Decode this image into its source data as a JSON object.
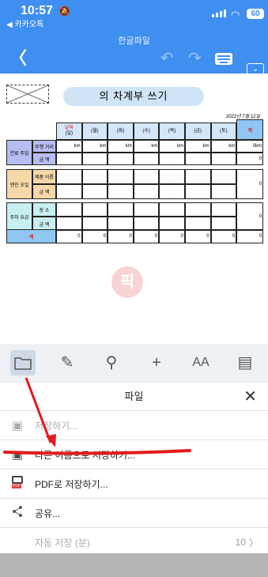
{
  "status": {
    "time": "10:57",
    "back_app": "◀ 카카오톡",
    "battery": "60"
  },
  "header": {
    "title": "한글파일"
  },
  "document": {
    "title": "의 차계부 쓰기",
    "date": "2022년 7월 12일",
    "days": [
      {
        "top": "날짜",
        "bottom": "(일)"
      },
      {
        "top": "",
        "bottom": "(월)"
      },
      {
        "top": "",
        "bottom": "(화)"
      },
      {
        "top": "",
        "bottom": "(수)"
      },
      {
        "top": "",
        "bottom": "(목)"
      },
      {
        "top": "",
        "bottom": "(금)"
      },
      {
        "top": "",
        "bottom": "(토)"
      }
    ],
    "total_header": "계",
    "fuel": {
      "label": "연료 주입",
      "sub1": "주행 거리",
      "sub2": "금 액",
      "unit": "km",
      "total_km": "0km",
      "total_amount": "0"
    },
    "oil": {
      "label": "엔진 오일",
      "sub1": "제품 이름",
      "sub2": "금 액",
      "total": "0"
    },
    "park": {
      "label": "주차 요금",
      "sub1": "장 소",
      "sub2": "금 액",
      "total": "0"
    },
    "sum": {
      "label": "계",
      "values": [
        "0",
        "0",
        "0",
        "0",
        "0",
        "0",
        "0",
        "0"
      ]
    },
    "watermark": "픽"
  },
  "toolbar": {
    "icons": [
      "folder-icon",
      "pen-edit-icon",
      "search-icon",
      "plus-icon",
      "font-size-icon",
      "layout-icon"
    ]
  },
  "file_sheet": {
    "title": "파일",
    "items": [
      {
        "label": "저장하기...",
        "icon": "save-icon",
        "enabled": false
      },
      {
        "label": "다른 이름으로 저장하기...",
        "icon": "save-as-icon",
        "enabled": true
      },
      {
        "label": "PDF로 저장하기...",
        "icon": "pdf-icon",
        "enabled": true
      },
      {
        "label": "공유...",
        "icon": "share-icon",
        "enabled": true
      },
      {
        "label": "자동 저장 (분)",
        "icon": "",
        "enabled": false,
        "value": "10"
      }
    ]
  },
  "colors": {
    "primary": "#3f8ff0",
    "annotation": "#e21b1b",
    "toolbar_bg": "#eef1f5"
  }
}
